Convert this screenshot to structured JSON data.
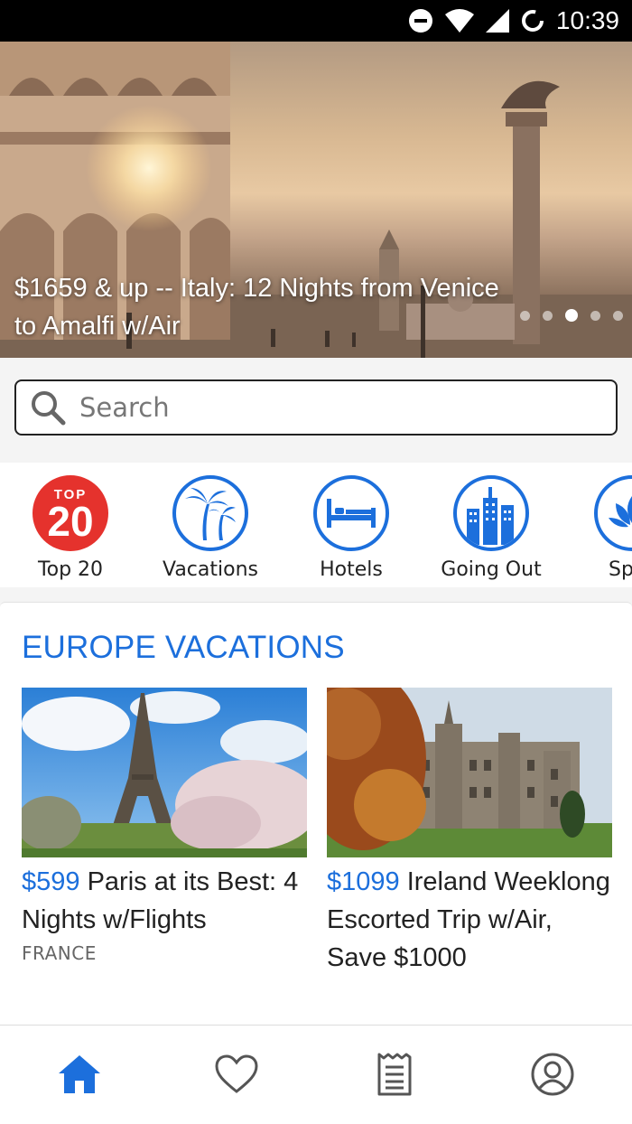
{
  "status_bar": {
    "time": "10:39",
    "icons": [
      "do-not-disturb-icon",
      "wifi-icon",
      "signal-icon",
      "sync-icon"
    ]
  },
  "hero": {
    "caption": "$1659 & up -- Italy: 12 Nights from Venice to Amalfi w/Air",
    "slide_count": 5,
    "active_slide": 3
  },
  "search": {
    "placeholder": "Search",
    "value": ""
  },
  "categories": [
    {
      "label": "Top 20",
      "icon": "top-20-icon",
      "badge_top": "TOP",
      "badge_num": "20"
    },
    {
      "label": "Vacations",
      "icon": "palm-trees-icon"
    },
    {
      "label": "Hotels",
      "icon": "bed-icon"
    },
    {
      "label": "Going Out",
      "icon": "city-buildings-icon"
    },
    {
      "label": "Sp",
      "icon": "spa-lotus-icon"
    }
  ],
  "europe_section": {
    "title": "EUROPE VACATIONS",
    "deals": [
      {
        "price": "$599",
        "title": "Paris at its Best: 4 Nights w/Flights",
        "country": "FRANCE",
        "image": "eiffel-tower-photo"
      },
      {
        "price": "$1099",
        "title": "Ireland Weeklong Escorted Trip w/Air, Save $1000",
        "country": "",
        "image": "irish-castle-photo"
      }
    ]
  },
  "bottom_nav": {
    "items": [
      "home-icon",
      "heart-icon",
      "receipt-icon",
      "profile-icon"
    ],
    "active": "home-icon"
  },
  "colors": {
    "accent": "#1c6fdc",
    "top20_red": "#e5322d",
    "text_dark": "#222222"
  }
}
